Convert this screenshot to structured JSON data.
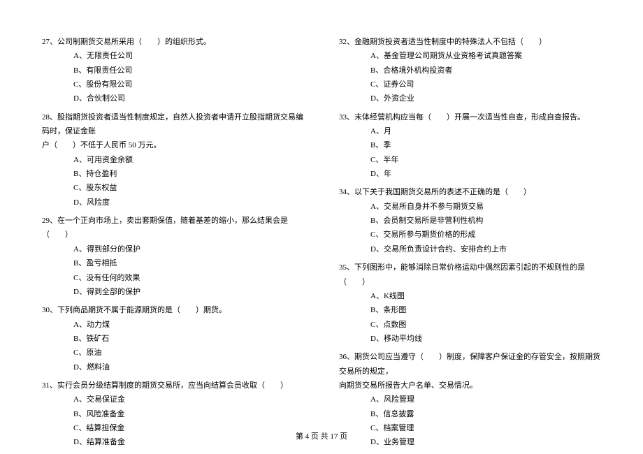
{
  "footer": "第 4 页 共 17 页",
  "left": [
    {
      "num": "27",
      "stem": "公司制期货交易所采用（　　）的组织形式。",
      "options": [
        "A、无限责任公司",
        "B、有限责任公司",
        "C、股份有限公司",
        "D、合伙制公司"
      ]
    },
    {
      "num": "28",
      "stem": "股指期货投资者适当性制度规定，自然人投资者申请开立股指期货交易编码时，保证金账",
      "cont": "户（　　）不低于人民币 50 万元。",
      "options": [
        "A、可用资金余额",
        "B、持仓盈利",
        "C、股东权益",
        "D、风险度"
      ]
    },
    {
      "num": "29",
      "stem": "在一个正向市场上，卖出套期保值，随着基差的缩小，那么结果会是（　　）",
      "options": [
        "A、得到部分的保护",
        "B、盈亏相抵",
        "C、没有任何的效果",
        "D、得到全部的保护"
      ]
    },
    {
      "num": "30",
      "stem": "下列商品期货不属于能源期货的是（　　）期货。",
      "options": [
        "A、动力煤",
        "B、铁矿石",
        "C、原油",
        "D、燃料油"
      ]
    },
    {
      "num": "31",
      "stem": "实行会员分级结算制度的期货交易所，应当向结算会员收取（　　）",
      "options": [
        "A、交易保证金",
        "B、风险准备金",
        "C、结算担保金",
        "D、结算准备金"
      ]
    }
  ],
  "right": [
    {
      "num": "32",
      "stem": "金融期货投资者适当性制度中的特殊法人不包括（　　）",
      "options": [
        "A、基金管理公司期货从业资格考试真题答案",
        "B、合格境外机构投资者",
        "C、证券公司",
        "D、外资企业"
      ]
    },
    {
      "num": "33",
      "stem": "末体经营机构应当每（　　）开展一次适当性自查，形成自查报告。",
      "options": [
        "A、月",
        "B、季",
        "C、半年",
        "D、年"
      ]
    },
    {
      "num": "34",
      "stem": "以下关于我国期货交易所的表述不正确的是（　　）",
      "options": [
        "A、交易所自身并不参与期货交易",
        "B、会员制交易所是非营利性机构",
        "C、交易所参与期货价格的形成",
        "D、交易所负责设计合约、安排合约上市"
      ]
    },
    {
      "num": "35",
      "stem": "下列图形中，能够消除日常价格运动中偶然因素引起的不规则性的是（　　）",
      "options": [
        "A、K线图",
        "B、条形图",
        "C、点数图",
        "D、移动平均线"
      ]
    },
    {
      "num": "36",
      "stem": "期货公司应当遵守（　　）制度，保障客户保证金的存管安全，按照期货交易所的规定，",
      "cont": "向期货交易所报告大户名单、交易情况。",
      "options": [
        "A、风险管理",
        "B、信息披露",
        "C、档案管理",
        "D、业务管理"
      ]
    }
  ]
}
